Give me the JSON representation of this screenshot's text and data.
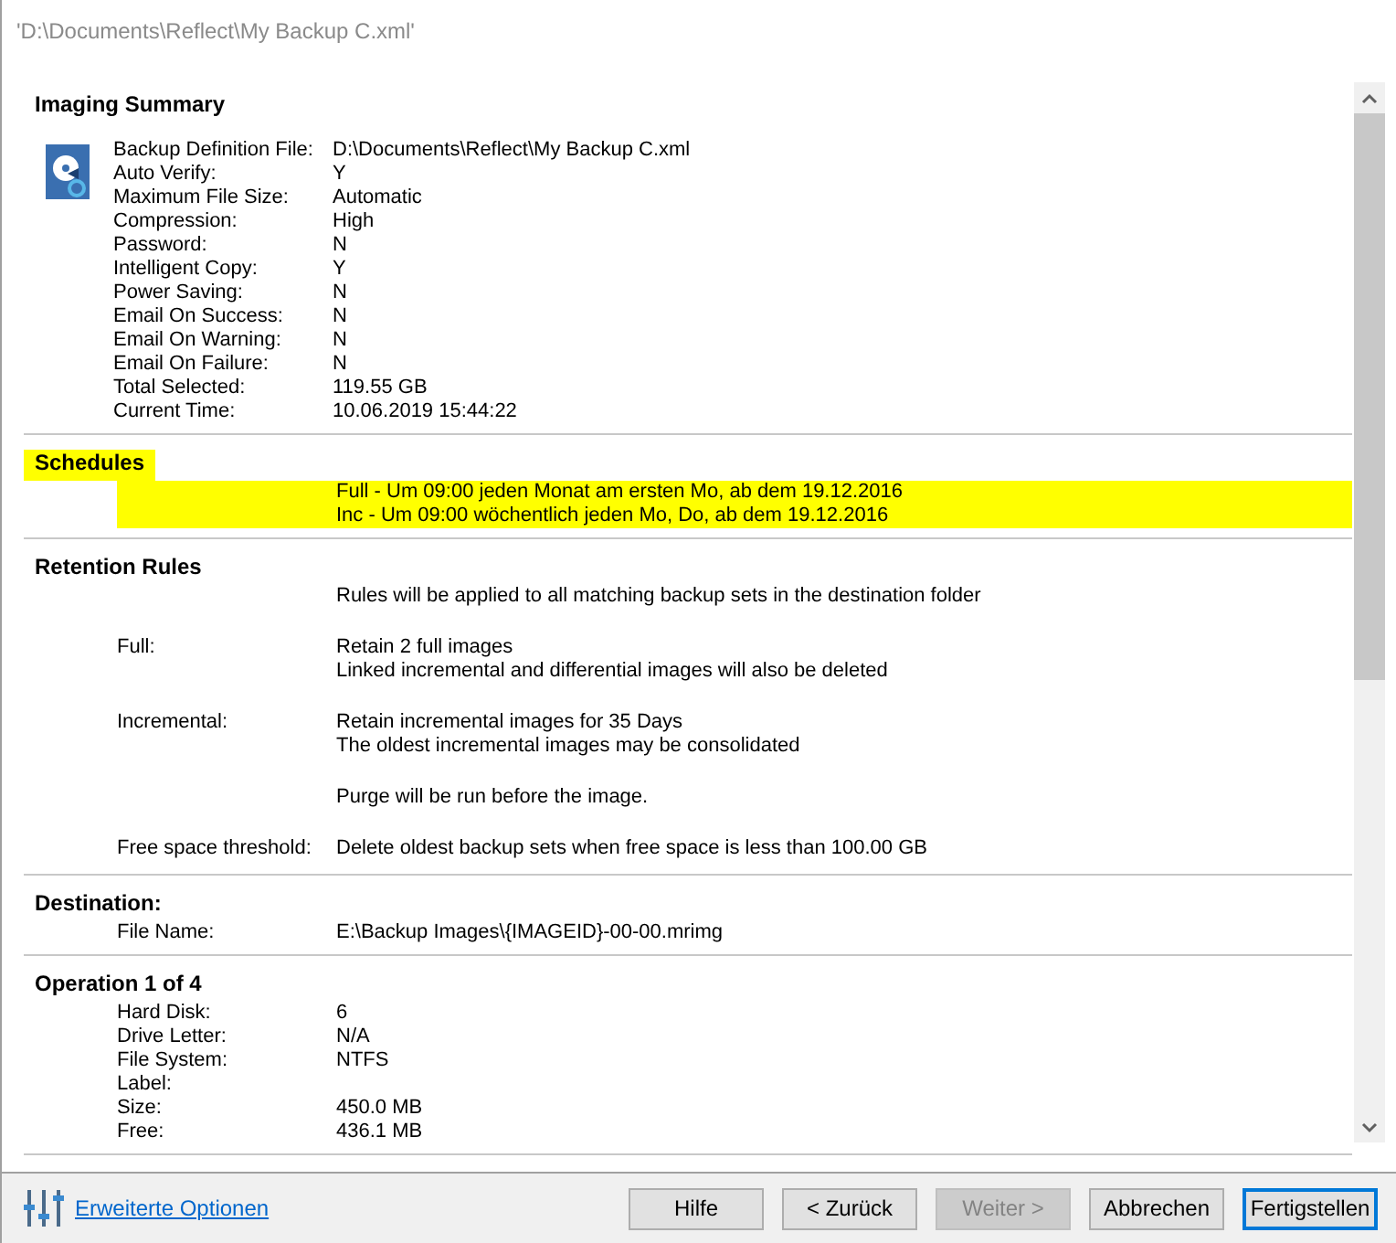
{
  "window": {
    "title": "'D:\\Documents\\Reflect\\My Backup C.xml'"
  },
  "sections": [
    {
      "title": "Imaging Summary",
      "kind": "summary",
      "highlighted": false,
      "spaced": false,
      "rows": [
        {
          "label": "Backup Definition File:",
          "lines": [
            "D:\\Documents\\Reflect\\My Backup C.xml"
          ],
          "highlighted": false
        },
        {
          "label": "Auto Verify:",
          "lines": [
            "Y"
          ],
          "highlighted": false
        },
        {
          "label": "Maximum File Size:",
          "lines": [
            "Automatic"
          ],
          "highlighted": false
        },
        {
          "label": "Compression:",
          "lines": [
            "High"
          ],
          "highlighted": false
        },
        {
          "label": "Password:",
          "lines": [
            "N"
          ],
          "highlighted": false
        },
        {
          "label": "Intelligent Copy:",
          "lines": [
            "Y"
          ],
          "highlighted": false
        },
        {
          "label": "Power Saving:",
          "lines": [
            "N"
          ],
          "highlighted": false
        },
        {
          "label": "Email On Success:",
          "lines": [
            "N"
          ],
          "highlighted": false
        },
        {
          "label": "Email On Warning:",
          "lines": [
            "N"
          ],
          "highlighted": false
        },
        {
          "label": "Email On Failure:",
          "lines": [
            "N"
          ],
          "highlighted": false
        },
        {
          "label": "Total Selected:",
          "lines": [
            "119.55 GB"
          ],
          "highlighted": false
        },
        {
          "label": "Current Time:",
          "lines": [
            "10.06.2019 15:44:22"
          ],
          "highlighted": false
        }
      ]
    },
    {
      "title": "Schedules",
      "kind": "plain",
      "highlighted": true,
      "spaced": false,
      "rows": [
        {
          "lines": [
            "Full - Um 09:00 jeden Monat am ersten Mo, ab dem 19.12.2016"
          ],
          "highlighted": true
        },
        {
          "lines": [
            "Inc - Um 09:00 wöchentlich jeden Mo, Do, ab dem 19.12.2016"
          ],
          "highlighted": true
        }
      ]
    },
    {
      "title": "Retention Rules",
      "kind": "plain",
      "highlighted": false,
      "spaced": true,
      "rows": [
        {
          "lines": [
            "Rules will be applied to all matching backup sets in the destination folder"
          ],
          "highlighted": false
        },
        {
          "label": "Full:",
          "lines": [
            "Retain 2 full images",
            "Linked incremental and differential images will also be deleted"
          ],
          "highlighted": false
        },
        {
          "label": "Incremental:",
          "lines": [
            "Retain incremental images for 35 Days",
            "The oldest incremental images may be consolidated"
          ],
          "highlighted": false
        },
        {
          "lines": [
            "Purge will be run before the image."
          ],
          "highlighted": false
        },
        {
          "label": "Free space threshold:",
          "lines": [
            "Delete oldest backup sets when free space is less than 100.00 GB"
          ],
          "highlighted": false
        }
      ]
    },
    {
      "title": "Destination:",
      "kind": "plain",
      "highlighted": false,
      "spaced": false,
      "rows": [
        {
          "label": "File Name:",
          "lines": [
            "E:\\Backup Images\\{IMAGEID}-00-00.mrimg"
          ],
          "highlighted": false
        }
      ]
    },
    {
      "title": "Operation 1 of 4",
      "kind": "plain",
      "highlighted": false,
      "spaced": false,
      "rows": [
        {
          "label": "Hard Disk:",
          "lines": [
            "6"
          ],
          "highlighted": false
        },
        {
          "label": "Drive Letter:",
          "lines": [
            "N/A"
          ],
          "highlighted": false
        },
        {
          "label": "File System:",
          "lines": [
            "NTFS"
          ],
          "highlighted": false
        },
        {
          "label": "Label:",
          "lines": [],
          "highlighted": false
        },
        {
          "label": "Size:",
          "lines": [
            "450.0 MB"
          ],
          "highlighted": false
        },
        {
          "label": "Free:",
          "lines": [
            "436.1 MB"
          ],
          "highlighted": false
        }
      ]
    }
  ],
  "footer": {
    "link": "Erweiterte Optionen",
    "buttons": [
      {
        "label": "Hilfe",
        "disabled": false,
        "default": false
      },
      {
        "label": "< Zurück",
        "disabled": false,
        "default": false
      },
      {
        "label": "Weiter >",
        "disabled": true,
        "default": false
      },
      {
        "label": "Abbrechen",
        "disabled": false,
        "default": false
      },
      {
        "label": "Fertigstellen",
        "disabled": false,
        "default": true
      }
    ]
  }
}
